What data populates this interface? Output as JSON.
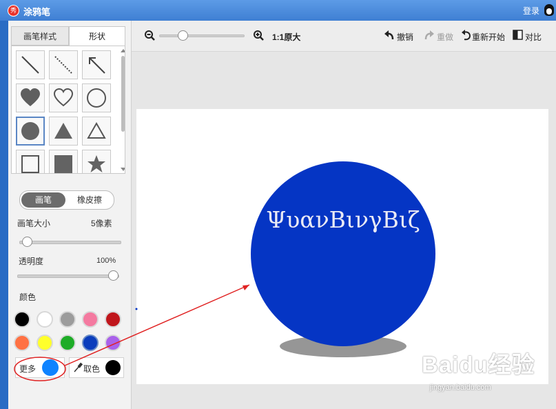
{
  "app": {
    "title": "涂鸦笔",
    "logo_char": "秀",
    "login": "登录"
  },
  "tabs": [
    {
      "label": "画笔样式",
      "active": false
    },
    {
      "label": "形状",
      "active": true
    }
  ],
  "shapes": [
    {
      "name": "line",
      "selected": false
    },
    {
      "name": "dashed-line",
      "selected": false
    },
    {
      "name": "arrow",
      "selected": false
    },
    {
      "name": "filled-heart",
      "selected": false
    },
    {
      "name": "outline-heart",
      "selected": false
    },
    {
      "name": "outline-circle",
      "selected": false
    },
    {
      "name": "filled-circle",
      "selected": true
    },
    {
      "name": "filled-triangle",
      "selected": false
    },
    {
      "name": "outline-triangle",
      "selected": false
    },
    {
      "name": "outline-square",
      "selected": false
    },
    {
      "name": "filled-square",
      "selected": false
    },
    {
      "name": "filled-star",
      "selected": false
    }
  ],
  "mode": {
    "brush": "画笔",
    "eraser": "橡皮擦",
    "active": "brush"
  },
  "brush_size": {
    "label": "画笔大小",
    "value": "5像素",
    "level": 0.03
  },
  "opacity": {
    "label": "透明度",
    "value": "100%",
    "level": 1.0
  },
  "colors": {
    "label": "颜色",
    "swatches": [
      "#000000",
      "#ffffff",
      "#9c9c9c",
      "#f47aa0",
      "#c0161c",
      "#ff7143",
      "#ffff2b",
      "#1eac27",
      "#0b3dbc",
      "#a961ea"
    ],
    "selected_index": 8,
    "more_label": "更多",
    "more_color": "#0f83ff",
    "picker_label": "取色",
    "picker_color": "#000000"
  },
  "toolbar": {
    "zoom_level": 0.25,
    "ratio_label": "1:1原大",
    "undo": "撤销",
    "redo": "重做",
    "restart": "重新开始",
    "compare": "对比"
  },
  "canvas": {
    "circle_color": "#0535c4",
    "shadow_color": "#969696",
    "circle_text": "ΨυανΒινγΒιζ",
    "circle_text_color": "#eaeaf5"
  },
  "annotation_color": "#e02222",
  "watermark": {
    "main": "Baidu经验",
    "sub": "jingyan.baidu.com"
  }
}
